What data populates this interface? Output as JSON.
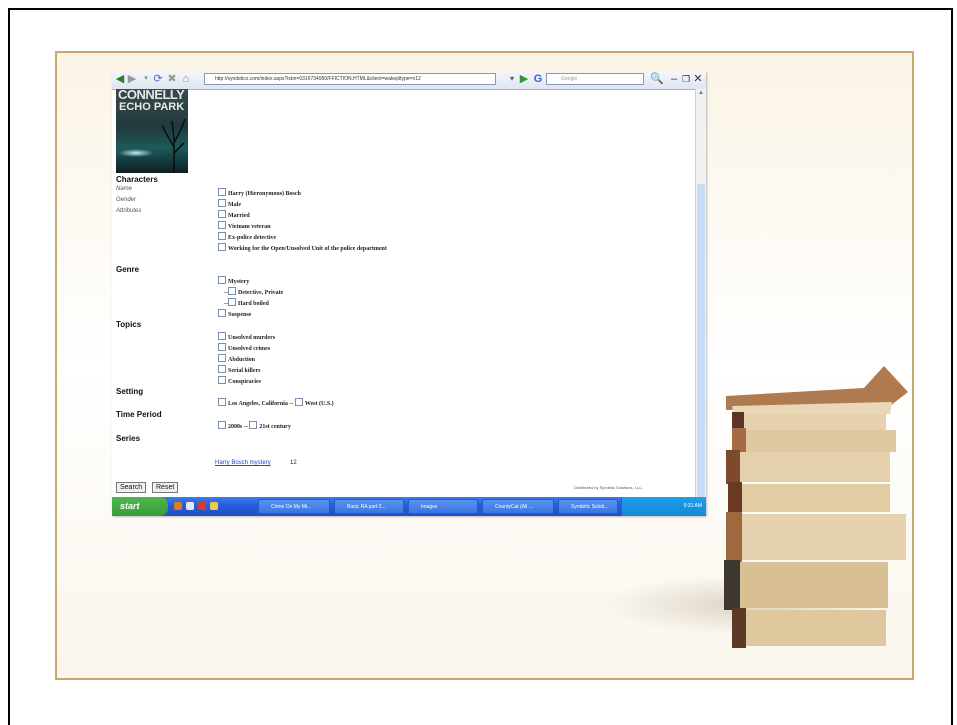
{
  "browser": {
    "url": "http://syndetics.com/index.aspx?isbn=0316734950/FFICTION.HTML&client=wakepltype=n12",
    "search_placeholder": "Google"
  },
  "book": {
    "cover_author": "CONNELLY",
    "cover_title": "ECHO PARK"
  },
  "sections": {
    "characters": "Characters",
    "characters_labels": [
      "Name",
      "Gender",
      "Attributes"
    ],
    "characters_items": [
      "Harry (Hieronymous) Bosch",
      "Male",
      "Married",
      "Vietnam veteran",
      "Ex-police detective",
      "Working for the Open/Unsolved Unit of the police department"
    ],
    "genre": "Genre",
    "genre_items": [
      "Mystery",
      "Detective, Private",
      "Hard boiled",
      "Suspense"
    ],
    "genre_prefix": "--",
    "topics": "Topics",
    "topics_items": [
      "Unsolved murders",
      "Unsolved crimes",
      "Abduction",
      "Serial killers",
      "Conspiracies"
    ],
    "setting": "Setting",
    "setting_items": [
      "Los Angeles, California --",
      "West (U.S.)"
    ],
    "time_period": "Time Period",
    "time_items": [
      "2000s --",
      "21st century"
    ],
    "series": "Series",
    "series_link": "Harry Bosch mystery",
    "series_count": "12"
  },
  "buttons": {
    "search": "Search",
    "reset": "Reset"
  },
  "footer_note": "Distributed by Syndetic Solutions, LLC.",
  "taskbar": {
    "start": "start",
    "tasks": [
      "Crime On My Mi...",
      "Basic RA part 2...",
      "Images",
      "CountyCat (All ...",
      "Syndetic Solub..."
    ],
    "clock": "9:31 AM"
  }
}
